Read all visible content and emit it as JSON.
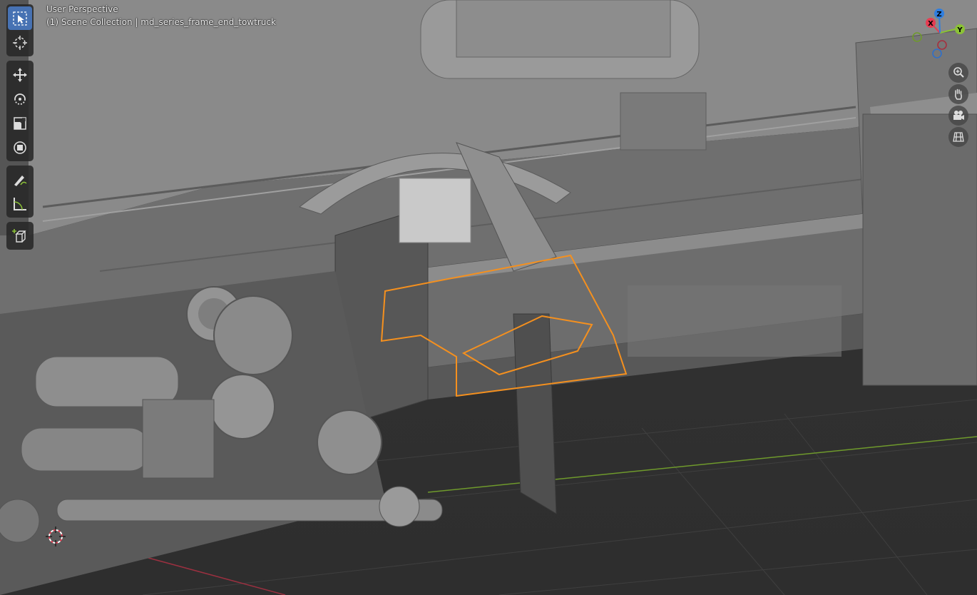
{
  "header": {
    "view_name": "User Perspective",
    "collection": "(1) Scene Collection | md_series_frame_end_towtruck"
  },
  "toolbar": {
    "groups": [
      [
        {
          "name": "select-box-icon",
          "active": true
        },
        {
          "name": "cursor-icon",
          "active": false
        }
      ],
      [
        {
          "name": "move-icon",
          "active": false
        },
        {
          "name": "rotate-icon",
          "active": false
        },
        {
          "name": "scale-icon",
          "active": false
        },
        {
          "name": "transform-icon",
          "active": false
        }
      ],
      [
        {
          "name": "annotate-icon",
          "active": false
        },
        {
          "name": "measure-icon",
          "active": false
        }
      ],
      [
        {
          "name": "add-cube-icon",
          "active": false
        }
      ]
    ]
  },
  "gizmo": {
    "x_label": "X",
    "y_label": "Y",
    "z_label": "Z"
  },
  "navigation": [
    "zoom-icon",
    "pan-hand-icon",
    "camera-icon",
    "grid-view-icon"
  ],
  "colors": {
    "active_tool": "#4772b3",
    "selection_outline": "#f5901e",
    "axis_x": "#e63d52",
    "axis_y": "#8bc236",
    "axis_z": "#2f7fe0"
  }
}
